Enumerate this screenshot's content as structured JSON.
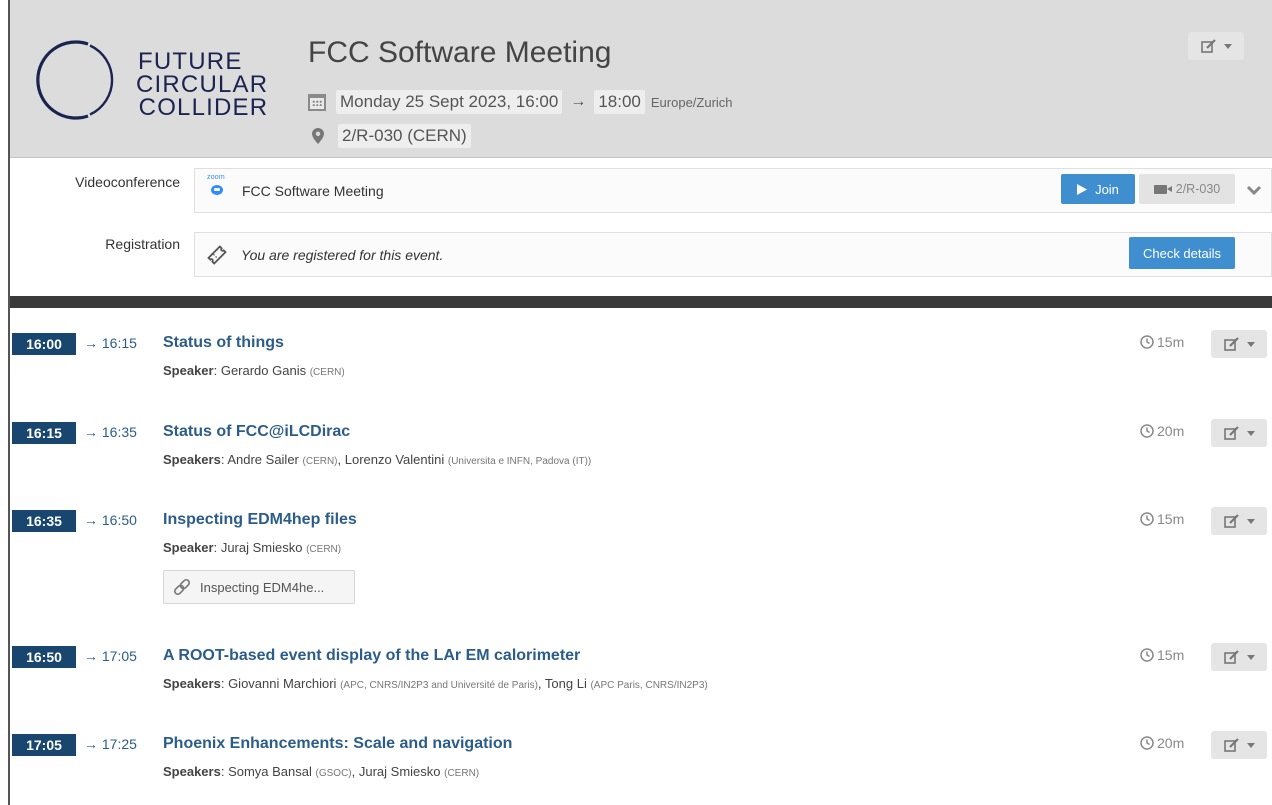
{
  "event": {
    "logo_lines": [
      "FUTURE",
      "CIRCULAR",
      "COLLIDER"
    ],
    "title": "FCC Software Meeting",
    "date": "Monday 25 Sept 2023, 16:00",
    "arrow": "→",
    "end_time": "18:00",
    "timezone": "Europe/Zurich",
    "room": "2/R-030 (CERN)"
  },
  "videoconference": {
    "label": "Videoconference",
    "provider_text": "zoom",
    "title": "FCC Software Meeting",
    "join_label": "Join",
    "room_label": "2/R-030"
  },
  "registration": {
    "label": "Registration",
    "message": "You are registered for this event.",
    "button_label": "Check details"
  },
  "entries": [
    {
      "start": "16:00",
      "end": "→ 16:15",
      "title": "Status of things",
      "duration": "15m",
      "speaker_label": "Speaker",
      "speakers": [
        {
          "name": "Gerardo Ganis",
          "aff": "(CERN)"
        }
      ]
    },
    {
      "start": "16:15",
      "end": "→ 16:35",
      "title": "Status of FCC@iLCDirac",
      "duration": "20m",
      "speaker_label": "Speakers",
      "speakers": [
        {
          "name": "Andre Sailer",
          "aff": "(CERN)"
        },
        {
          "name": "Lorenzo Valentini",
          "aff": "(Universita e INFN, Padova (IT))"
        }
      ]
    },
    {
      "start": "16:35",
      "end": "→ 16:50",
      "title": "Inspecting EDM4hep files",
      "duration": "15m",
      "speaker_label": "Speaker",
      "speakers": [
        {
          "name": "Juraj Smiesko",
          "aff": "(CERN)"
        }
      ],
      "attachment": "Inspecting EDM4he..."
    },
    {
      "start": "16:50",
      "end": "→ 17:05",
      "title": "A ROOT-based event display of the LAr EM calorimeter",
      "duration": "15m",
      "speaker_label": "Speakers",
      "speakers": [
        {
          "name": "Giovanni Marchiori",
          "aff": "(APC, CNRS/IN2P3 and Université de Paris)"
        },
        {
          "name": "Tong Li",
          "aff": "(APC Paris, CNRS/IN2P3)"
        }
      ]
    },
    {
      "start": "17:05",
      "end": "→ 17:25",
      "title": "Phoenix Enhancements: Scale and navigation",
      "duration": "20m",
      "speaker_label": "Speakers",
      "speakers": [
        {
          "name": "Somya Bansal",
          "aff": "(GSOC)"
        },
        {
          "name": "Juraj Smiesko",
          "aff": "(CERN)"
        }
      ]
    }
  ],
  "colors": {
    "header_bg": "#dcdcdc",
    "accent_blue": "#3e8ed0",
    "time_badge": "#19466e",
    "link_blue": "#2c5d8a",
    "logo_navy": "#1b2450"
  },
  "icons": [
    "edit-icon",
    "calendar-icon",
    "map-pin-icon",
    "zoom-logo",
    "play-icon",
    "camera-icon",
    "chevron-down-icon",
    "ticket-icon",
    "clock-icon",
    "link-icon"
  ]
}
